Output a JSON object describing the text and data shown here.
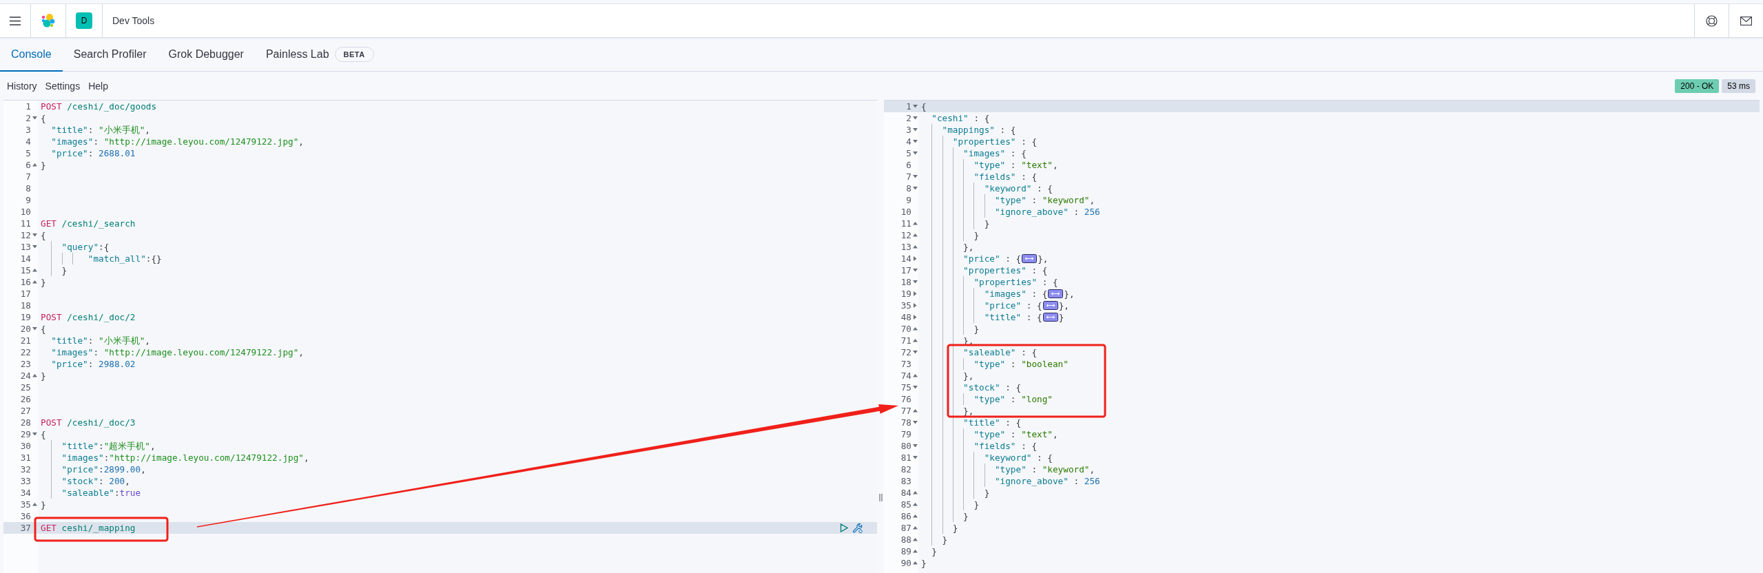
{
  "header": {
    "space_badge": "D",
    "title": "Dev Tools"
  },
  "tabs": [
    {
      "label": "Console",
      "selected": true
    },
    {
      "label": "Search Profiler",
      "selected": false
    },
    {
      "label": "Grok Debugger",
      "selected": false
    },
    {
      "label": "Painless Lab",
      "selected": false,
      "badge": "BETA"
    }
  ],
  "toolbar": {
    "items": [
      "History",
      "Settings",
      "Help"
    ],
    "status": "200 - OK",
    "time": "53 ms"
  },
  "request_editor": {
    "lines": [
      {
        "n": "1",
        "kind": "plain",
        "active": false,
        "tokens": [
          {
            "kind": "method",
            "text": "POST"
          },
          {
            "kind": "path",
            "text": " /ceshi/_doc/goods"
          }
        ]
      },
      {
        "n": "2",
        "kind": "block_start",
        "expanded": true,
        "active": false,
        "tokens": [
          {
            "kind": "punct",
            "text": "{"
          }
        ]
      },
      {
        "n": "3",
        "kind": "plain",
        "active": false,
        "tokens": [
          {
            "kind": "key",
            "text": "  \"title\""
          },
          {
            "kind": "punct",
            "text": ": "
          },
          {
            "kind": "string",
            "text": "\"小米手机\""
          },
          {
            "kind": "punct",
            "text": ","
          }
        ]
      },
      {
        "n": "4",
        "kind": "plain",
        "active": false,
        "tokens": [
          {
            "kind": "key",
            "text": "  \"images\""
          },
          {
            "kind": "punct",
            "text": ": "
          },
          {
            "kind": "string",
            "text": "\"http://image.leyou.com/12479122.jpg\""
          },
          {
            "kind": "punct",
            "text": ","
          }
        ]
      },
      {
        "n": "5",
        "kind": "plain",
        "active": false,
        "tokens": [
          {
            "kind": "key",
            "text": "  \"price\""
          },
          {
            "kind": "punct",
            "text": ": "
          },
          {
            "kind": "number",
            "text": "2688.01"
          }
        ]
      },
      {
        "n": "6",
        "kind": "block_end",
        "active": false,
        "tokens": [
          {
            "kind": "punct",
            "text": "}"
          }
        ]
      },
      {
        "n": "7",
        "kind": "plain",
        "active": false
      },
      {
        "n": "8",
        "kind": "plain",
        "active": false
      },
      {
        "n": "9",
        "kind": "plain",
        "active": false
      },
      {
        "n": "10",
        "kind": "plain",
        "active": false
      },
      {
        "n": "11",
        "kind": "plain",
        "active": false,
        "tokens": [
          {
            "kind": "method",
            "text": "GET"
          },
          {
            "kind": "path",
            "text": " /ceshi/_search"
          }
        ]
      },
      {
        "n": "12",
        "kind": "block_start",
        "expanded": true,
        "active": false,
        "tokens": [
          {
            "kind": "punct",
            "text": "{"
          }
        ]
      },
      {
        "n": "13",
        "kind": "block_start",
        "expanded": true,
        "active": false,
        "tokens": [
          {
            "kind": "key",
            "text": "    \"query\""
          },
          {
            "kind": "punct",
            "text": ":{"
          }
        ]
      },
      {
        "n": "14",
        "kind": "plain",
        "active": false,
        "tokens": [
          {
            "kind": "key",
            "text": "         \"match_all\""
          },
          {
            "kind": "punct",
            "text": ":{}"
          }
        ]
      },
      {
        "n": "15",
        "kind": "block_end",
        "active": false,
        "tokens": [
          {
            "kind": "punct",
            "text": "    }"
          }
        ]
      },
      {
        "n": "16",
        "kind": "block_end",
        "active": false,
        "tokens": [
          {
            "kind": "punct",
            "text": "}"
          }
        ]
      },
      {
        "n": "17",
        "kind": "plain",
        "active": false
      },
      {
        "n": "18",
        "kind": "plain",
        "active": false
      },
      {
        "n": "19",
        "kind": "plain",
        "active": false,
        "tokens": [
          {
            "kind": "method",
            "text": "POST"
          },
          {
            "kind": "path",
            "text": " /ceshi/_doc/2"
          }
        ]
      },
      {
        "n": "20",
        "kind": "block_start",
        "expanded": true,
        "active": false,
        "tokens": [
          {
            "kind": "punct",
            "text": "{"
          }
        ]
      },
      {
        "n": "21",
        "kind": "plain",
        "active": false,
        "tokens": [
          {
            "kind": "key",
            "text": "  \"title\""
          },
          {
            "kind": "punct",
            "text": ": "
          },
          {
            "kind": "string",
            "text": "\"小米手机\""
          },
          {
            "kind": "punct",
            "text": ","
          }
        ]
      },
      {
        "n": "22",
        "kind": "plain",
        "active": false,
        "tokens": [
          {
            "kind": "key",
            "text": "  \"images\""
          },
          {
            "kind": "punct",
            "text": ": "
          },
          {
            "kind": "string",
            "text": "\"http://image.leyou.com/12479122.jpg\""
          },
          {
            "kind": "punct",
            "text": ","
          }
        ]
      },
      {
        "n": "23",
        "kind": "plain",
        "active": false,
        "tokens": [
          {
            "kind": "key",
            "text": "  \"price\""
          },
          {
            "kind": "punct",
            "text": ": "
          },
          {
            "kind": "number",
            "text": "2988.02"
          }
        ]
      },
      {
        "n": "24",
        "kind": "block_end",
        "active": false,
        "tokens": [
          {
            "kind": "punct",
            "text": "}"
          }
        ]
      },
      {
        "n": "25",
        "kind": "plain",
        "active": false
      },
      {
        "n": "26",
        "kind": "plain",
        "active": false
      },
      {
        "n": "27",
        "kind": "plain",
        "active": false
      },
      {
        "n": "28",
        "kind": "plain",
        "active": false,
        "tokens": [
          {
            "kind": "method",
            "text": "POST"
          },
          {
            "kind": "path",
            "text": " /ceshi/_doc/3"
          }
        ]
      },
      {
        "n": "29",
        "kind": "block_start",
        "expanded": true,
        "active": false,
        "tokens": [
          {
            "kind": "punct",
            "text": "{"
          }
        ]
      },
      {
        "n": "30",
        "kind": "plain",
        "active": false,
        "tokens": [
          {
            "kind": "key",
            "text": "    \"title\""
          },
          {
            "kind": "punct",
            "text": ":"
          },
          {
            "kind": "string",
            "text": "\"超米手机\""
          },
          {
            "kind": "punct",
            "text": ","
          }
        ]
      },
      {
        "n": "31",
        "kind": "plain",
        "active": false,
        "tokens": [
          {
            "kind": "key",
            "text": "    \"images\""
          },
          {
            "kind": "punct",
            "text": ":"
          },
          {
            "kind": "string",
            "text": "\"http://image.leyou.com/12479122.jpg\""
          },
          {
            "kind": "punct",
            "text": ","
          }
        ]
      },
      {
        "n": "32",
        "kind": "plain",
        "active": false,
        "tokens": [
          {
            "kind": "key",
            "text": "    \"price\""
          },
          {
            "kind": "punct",
            "text": ":"
          },
          {
            "kind": "number",
            "text": "2899.00"
          },
          {
            "kind": "punct",
            "text": ","
          }
        ]
      },
      {
        "n": "33",
        "kind": "plain",
        "active": false,
        "tokens": [
          {
            "kind": "key",
            "text": "    \"stock\""
          },
          {
            "kind": "punct",
            "text": ": "
          },
          {
            "kind": "number",
            "text": "200"
          },
          {
            "kind": "punct",
            "text": ","
          }
        ]
      },
      {
        "n": "34",
        "kind": "plain",
        "active": false,
        "tokens": [
          {
            "kind": "key",
            "text": "    \"saleable\""
          },
          {
            "kind": "punct",
            "text": ":"
          },
          {
            "kind": "bool",
            "text": "true"
          }
        ]
      },
      {
        "n": "35",
        "kind": "block_end",
        "active": false,
        "tokens": [
          {
            "kind": "punct",
            "text": "}"
          }
        ]
      },
      {
        "n": "36",
        "kind": "plain",
        "active": false
      },
      {
        "n": "37",
        "kind": "plain",
        "active": true,
        "tokens": [
          {
            "kind": "method",
            "text": "GET"
          },
          {
            "kind": "path",
            "text": " ceshi/_mapping"
          }
        ]
      }
    ]
  },
  "response_editor": {
    "lines": [
      {
        "n": "1",
        "kind": "block_start",
        "expanded": true,
        "active": true,
        "tokens": [
          {
            "kind": "punct",
            "text": "{"
          }
        ]
      },
      {
        "n": "2",
        "kind": "block_start",
        "expanded": true,
        "active": false,
        "tokens": [
          {
            "kind": "key",
            "text": "  \"ceshi\""
          },
          {
            "kind": "punct",
            "text": " : {"
          }
        ]
      },
      {
        "n": "3",
        "kind": "block_start",
        "expanded": true,
        "active": false,
        "tokens": [
          {
            "kind": "key",
            "text": "    \"mappings\""
          },
          {
            "kind": "punct",
            "text": " : {"
          }
        ]
      },
      {
        "n": "4",
        "kind": "block_start",
        "expanded": true,
        "active": false,
        "tokens": [
          {
            "kind": "key",
            "text": "      \"properties\""
          },
          {
            "kind": "punct",
            "text": " : {"
          }
        ]
      },
      {
        "n": "5",
        "kind": "block_start",
        "expanded": true,
        "active": false,
        "tokens": [
          {
            "kind": "key",
            "text": "        \"images\""
          },
          {
            "kind": "punct",
            "text": " : {"
          }
        ]
      },
      {
        "n": "6",
        "kind": "plain",
        "active": false,
        "tokens": [
          {
            "kind": "key",
            "text": "          \"type\""
          },
          {
            "kind": "punct",
            "text": " : "
          },
          {
            "kind": "string",
            "text": "\"text\""
          },
          {
            "kind": "punct",
            "text": ","
          }
        ]
      },
      {
        "n": "7",
        "kind": "block_start",
        "expanded": true,
        "active": false,
        "tokens": [
          {
            "kind": "key",
            "text": "          \"fields\""
          },
          {
            "kind": "punct",
            "text": " : {"
          }
        ]
      },
      {
        "n": "8",
        "kind": "block_start",
        "expanded": true,
        "active": false,
        "tokens": [
          {
            "kind": "key",
            "text": "            \"keyword\""
          },
          {
            "kind": "punct",
            "text": " : {"
          }
        ]
      },
      {
        "n": "9",
        "kind": "plain",
        "active": false,
        "tokens": [
          {
            "kind": "key",
            "text": "              \"type\""
          },
          {
            "kind": "punct",
            "text": " : "
          },
          {
            "kind": "string",
            "text": "\"keyword\""
          },
          {
            "kind": "punct",
            "text": ","
          }
        ]
      },
      {
        "n": "10",
        "kind": "plain",
        "active": false,
        "tokens": [
          {
            "kind": "key",
            "text": "              \"ignore_above\""
          },
          {
            "kind": "punct",
            "text": " : "
          },
          {
            "kind": "number",
            "text": "256"
          }
        ]
      },
      {
        "n": "11",
        "kind": "block_end",
        "active": false,
        "tokens": [
          {
            "kind": "punct",
            "text": "            }"
          }
        ]
      },
      {
        "n": "12",
        "kind": "block_end",
        "active": false,
        "tokens": [
          {
            "kind": "punct",
            "text": "          }"
          }
        ]
      },
      {
        "n": "13",
        "kind": "block_end",
        "active": false,
        "tokens": [
          {
            "kind": "punct",
            "text": "        },"
          }
        ]
      },
      {
        "n": "14",
        "kind": "block_start",
        "expanded": false,
        "active": false,
        "tokens": [
          {
            "kind": "key",
            "text": "        \"price\""
          },
          {
            "kind": "punct",
            "text": " : {"
          },
          {
            "kind": "folded"
          },
          {
            "kind": "punct",
            "text": "},"
          }
        ]
      },
      {
        "n": "17",
        "kind": "block_start",
        "expanded": true,
        "active": false,
        "tokens": [
          {
            "kind": "key",
            "text": "        \"properties\""
          },
          {
            "kind": "punct",
            "text": " : {"
          }
        ]
      },
      {
        "n": "18",
        "kind": "block_start",
        "expanded": true,
        "active": false,
        "tokens": [
          {
            "kind": "key",
            "text": "          \"properties\""
          },
          {
            "kind": "punct",
            "text": " : {"
          }
        ]
      },
      {
        "n": "19",
        "kind": "block_start",
        "expanded": false,
        "active": false,
        "tokens": [
          {
            "kind": "key",
            "text": "            \"images\""
          },
          {
            "kind": "punct",
            "text": " : {"
          },
          {
            "kind": "folded"
          },
          {
            "kind": "punct",
            "text": "},"
          }
        ]
      },
      {
        "n": "35",
        "kind": "block_start",
        "expanded": false,
        "active": false,
        "tokens": [
          {
            "kind": "key",
            "text": "            \"price\""
          },
          {
            "kind": "punct",
            "text": " : {"
          },
          {
            "kind": "folded"
          },
          {
            "kind": "punct",
            "text": "},"
          }
        ]
      },
      {
        "n": "48",
        "kind": "block_start",
        "expanded": false,
        "active": false,
        "tokens": [
          {
            "kind": "key",
            "text": "            \"title\""
          },
          {
            "kind": "punct",
            "text": " : {"
          },
          {
            "kind": "folded"
          },
          {
            "kind": "punct",
            "text": "}"
          }
        ]
      },
      {
        "n": "70",
        "kind": "block_end",
        "active": false,
        "tokens": [
          {
            "kind": "punct",
            "text": "          }"
          }
        ]
      },
      {
        "n": "71",
        "kind": "block_end",
        "active": false,
        "tokens": [
          {
            "kind": "punct",
            "text": "        },"
          }
        ]
      },
      {
        "n": "72",
        "kind": "block_start",
        "expanded": true,
        "active": false,
        "tokens": [
          {
            "kind": "key",
            "text": "        \"saleable\""
          },
          {
            "kind": "punct",
            "text": " : {"
          }
        ]
      },
      {
        "n": "73",
        "kind": "plain",
        "active": false,
        "tokens": [
          {
            "kind": "key",
            "text": "          \"type\""
          },
          {
            "kind": "punct",
            "text": " : "
          },
          {
            "kind": "string",
            "text": "\"boolean\""
          }
        ]
      },
      {
        "n": "74",
        "kind": "block_end",
        "active": false,
        "tokens": [
          {
            "kind": "punct",
            "text": "        },"
          }
        ]
      },
      {
        "n": "75",
        "kind": "block_start",
        "expanded": true,
        "active": false,
        "tokens": [
          {
            "kind": "key",
            "text": "        \"stock\""
          },
          {
            "kind": "punct",
            "text": " : {"
          }
        ]
      },
      {
        "n": "76",
        "kind": "plain",
        "active": false,
        "tokens": [
          {
            "kind": "key",
            "text": "          \"type\""
          },
          {
            "kind": "punct",
            "text": " : "
          },
          {
            "kind": "string",
            "text": "\"long\""
          }
        ]
      },
      {
        "n": "77",
        "kind": "block_end",
        "active": false,
        "tokens": [
          {
            "kind": "punct",
            "text": "        },"
          }
        ]
      },
      {
        "n": "78",
        "kind": "block_start",
        "expanded": true,
        "active": false,
        "tokens": [
          {
            "kind": "key",
            "text": "        \"title\""
          },
          {
            "kind": "punct",
            "text": " : {"
          }
        ]
      },
      {
        "n": "79",
        "kind": "plain",
        "active": false,
        "tokens": [
          {
            "kind": "key",
            "text": "          \"type\""
          },
          {
            "kind": "punct",
            "text": " : "
          },
          {
            "kind": "string",
            "text": "\"text\""
          },
          {
            "kind": "punct",
            "text": ","
          }
        ]
      },
      {
        "n": "80",
        "kind": "block_start",
        "expanded": true,
        "active": false,
        "tokens": [
          {
            "kind": "key",
            "text": "          \"fields\""
          },
          {
            "kind": "punct",
            "text": " : {"
          }
        ]
      },
      {
        "n": "81",
        "kind": "block_start",
        "expanded": true,
        "active": false,
        "tokens": [
          {
            "kind": "key",
            "text": "            \"keyword\""
          },
          {
            "kind": "punct",
            "text": " : {"
          }
        ]
      },
      {
        "n": "82",
        "kind": "plain",
        "active": false,
        "tokens": [
          {
            "kind": "key",
            "text": "              \"type\""
          },
          {
            "kind": "punct",
            "text": " : "
          },
          {
            "kind": "string",
            "text": "\"keyword\""
          },
          {
            "kind": "punct",
            "text": ","
          }
        ]
      },
      {
        "n": "83",
        "kind": "plain",
        "active": false,
        "tokens": [
          {
            "kind": "key",
            "text": "              \"ignore_above\""
          },
          {
            "kind": "punct",
            "text": " : "
          },
          {
            "kind": "number",
            "text": "256"
          }
        ]
      },
      {
        "n": "84",
        "kind": "block_end",
        "active": false,
        "tokens": [
          {
            "kind": "punct",
            "text": "            }"
          }
        ]
      },
      {
        "n": "85",
        "kind": "block_end",
        "active": false,
        "tokens": [
          {
            "kind": "punct",
            "text": "          }"
          }
        ]
      },
      {
        "n": "86",
        "kind": "block_end",
        "active": false,
        "tokens": [
          {
            "kind": "punct",
            "text": "        }"
          }
        ]
      },
      {
        "n": "87",
        "kind": "block_end",
        "active": false,
        "tokens": [
          {
            "kind": "punct",
            "text": "      }"
          }
        ]
      },
      {
        "n": "88",
        "kind": "block_end",
        "active": false,
        "tokens": [
          {
            "kind": "punct",
            "text": "    }"
          }
        ]
      },
      {
        "n": "89",
        "kind": "block_end",
        "active": false,
        "tokens": [
          {
            "kind": "punct",
            "text": "  }"
          }
        ]
      },
      {
        "n": "90",
        "kind": "block_end",
        "active": false,
        "tokens": [
          {
            "kind": "punct",
            "text": "}"
          }
        ]
      }
    ]
  }
}
